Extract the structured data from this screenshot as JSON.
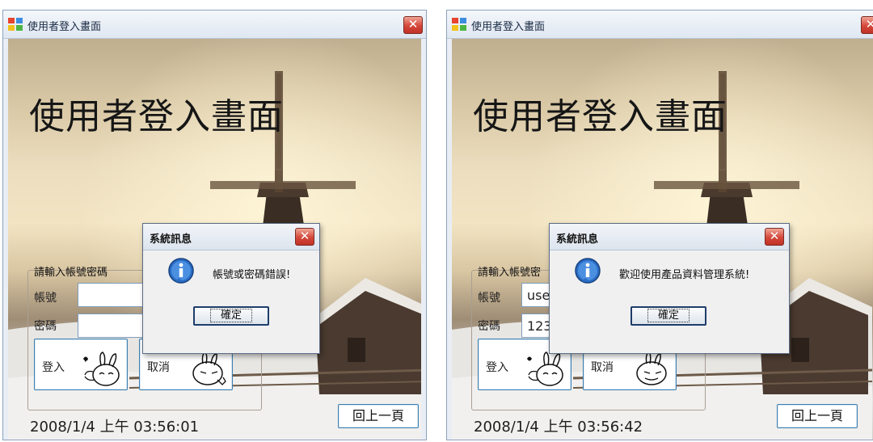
{
  "windows": [
    {
      "title": "使用者登入畫面",
      "form_title": "使用者登入畫面",
      "group_label": "請輸入帳號密碼",
      "account_label": "帳號",
      "password_label": "密碼",
      "account_value": "",
      "password_value": "",
      "login_label": "登入",
      "cancel_label": "取消",
      "timestamp": "2008/1/4 上午 03:56:01",
      "back_label": "回上一頁",
      "dialog": {
        "title": "系統訊息",
        "message": "帳號或密碼錯誤!",
        "ok_label": "確定"
      }
    },
    {
      "title": "使用者登入畫面",
      "form_title": "使用者登入畫面",
      "group_label": "請輸入帳號密",
      "account_label": "帳號",
      "password_label": "密碼",
      "account_value": "user",
      "password_value": "123",
      "login_label": "登入",
      "cancel_label": "取消",
      "timestamp": "2008/1/4 上午 03:56:42",
      "back_label": "回上一頁",
      "dialog": {
        "title": "系統訊息",
        "message": "歡迎使用產品資料管理系統!",
        "ok_label": "確定"
      }
    }
  ],
  "icons": {
    "app": "app-window-icon",
    "close": "close-x-icon",
    "info": "info-icon",
    "bunny": "bunny-icon"
  },
  "colors": {
    "close_red": "#d4473a",
    "border_blue": "#3c7fb1",
    "info_blue": "#2b6cc4"
  }
}
